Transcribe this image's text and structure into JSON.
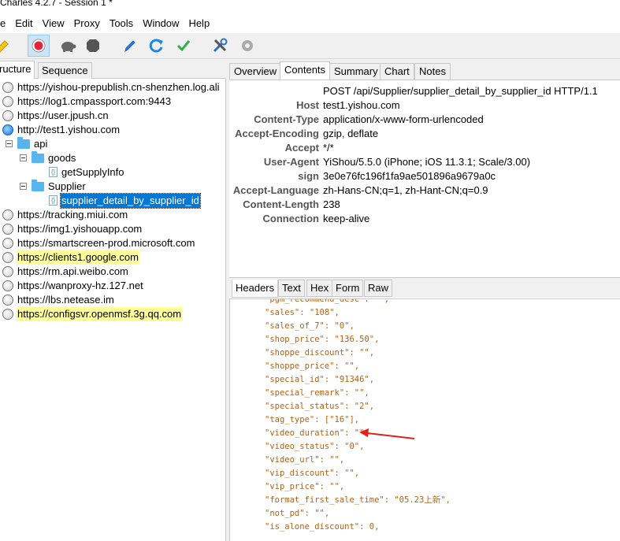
{
  "window": {
    "title": "Charles 4.2.7 - Session 1 *"
  },
  "menu": [
    "e",
    "Edit",
    "View",
    "Proxy",
    "Tools",
    "Window",
    "Help"
  ],
  "toolbar": {
    "items": [
      {
        "name": "pen-icon"
      },
      {
        "name": "record-icon",
        "active": true
      },
      {
        "name": "throttle-turtle-icon"
      },
      {
        "name": "breakpoint-stop-icon"
      },
      {
        "name": "compose-pen-icon"
      },
      {
        "name": "repeat-refresh-icon"
      },
      {
        "name": "validate-check-icon"
      },
      {
        "name": "tools-icon"
      },
      {
        "name": "settings-gear-icon"
      }
    ]
  },
  "left": {
    "tabs": [
      "ructure",
      "Sequence"
    ],
    "tree": [
      {
        "label": "https://yishou-prepublish.cn-shenzhen.log.ali",
        "level": 0,
        "icon": "globe"
      },
      {
        "label": "https://log1.cmpassport.com:9443",
        "level": 0,
        "icon": "globe"
      },
      {
        "label": "https://user.jpush.cn",
        "level": 0,
        "icon": "globe"
      },
      {
        "label": "http://test1.yishou.com",
        "level": 0,
        "icon": "globe-blue"
      },
      {
        "label": "api",
        "level": 1,
        "icon": "folder"
      },
      {
        "label": "goods",
        "level": 2,
        "icon": "folder"
      },
      {
        "label": "getSupplyInfo",
        "level": 3,
        "icon": "file"
      },
      {
        "label": "Supplier",
        "level": 2,
        "icon": "folder"
      },
      {
        "label": "supplier_detail_by_supplier_id",
        "level": 3,
        "icon": "file",
        "selected": true
      },
      {
        "label": "https://tracking.miui.com",
        "level": 0,
        "icon": "globe"
      },
      {
        "label": "https://img1.yishouapp.com",
        "level": 0,
        "icon": "globe"
      },
      {
        "label": "https://smartscreen-prod.microsoft.com",
        "level": 0,
        "icon": "globe"
      },
      {
        "label": "https://clients1.google.com",
        "level": 0,
        "icon": "globe",
        "highlight": true
      },
      {
        "label": "https://rm.api.weibo.com",
        "level": 0,
        "icon": "globe"
      },
      {
        "label": "https://wanproxy-hz.127.net",
        "level": 0,
        "icon": "globe"
      },
      {
        "label": "https://lbs.netease.im",
        "level": 0,
        "icon": "globe"
      },
      {
        "label": "https://configsvr.openmsf.3g.qq.com",
        "level": 0,
        "icon": "globe",
        "highlight": true
      }
    ]
  },
  "right": {
    "tabs": [
      "Overview",
      "Contents",
      "Summary",
      "Chart",
      "Notes"
    ],
    "active_tab": "Contents",
    "request_line": "POST /api/Supplier/supplier_detail_by_supplier_id HTTP/1.1",
    "headers": [
      {
        "k": "Host",
        "v": "test1.yishou.com"
      },
      {
        "k": "Content-Type",
        "v": "application/x-www-form-urlencoded"
      },
      {
        "k": "Accept-Encoding",
        "v": "gzip, deflate"
      },
      {
        "k": "Accept",
        "v": "*/*"
      },
      {
        "k": "User-Agent",
        "v": "YiShou/5.5.0 (iPhone; iOS 11.3.1; Scale/3.00)"
      },
      {
        "k": "sign",
        "v": "3e0e76fc196f1fa9ae501896a9679a0c"
      },
      {
        "k": "Accept-Language",
        "v": "zh-Hans-CN;q=1, zh-Hant-CN;q=0.9"
      },
      {
        "k": "Content-Length",
        "v": "238"
      },
      {
        "k": "Connection",
        "v": "keep-alive"
      }
    ],
    "bottom_tabs": [
      "Headers",
      "Text",
      "Hex",
      "Form",
      "Raw"
    ],
    "bottom_active": "Headers",
    "json_lines": [
      "\"pgm_recommend_desc\": \"\",",
      "\"sales\": \"108\",",
      "\"sales_of_7\": \"0\",",
      "\"shop_price\": \"136.50\",",
      "\"shoppe_discount\": \"\",",
      "\"shoppe_price\": \"\",",
      "\"special_id\": \"91346\",",
      "\"special_remark\": \"\",",
      "\"special_status\": \"2\",",
      "\"tag_type\": [\"16\"],",
      "\"video_duration\": \"\",",
      "\"video_status\": \"0\",",
      "\"video_url\": \"\",",
      "\"vip_discount\": \"\",",
      "\"vip_price\": \"\",",
      "\"format_first_sale_time\": \"05.23上新\",",
      "\"not_pd\": \"\",",
      "\"is_alone_discount\": 0,"
    ]
  },
  "colors": {
    "accent": "#0078d7",
    "highlight": "#ffff99",
    "json": "#b0621a",
    "arrow": "#e02020"
  }
}
